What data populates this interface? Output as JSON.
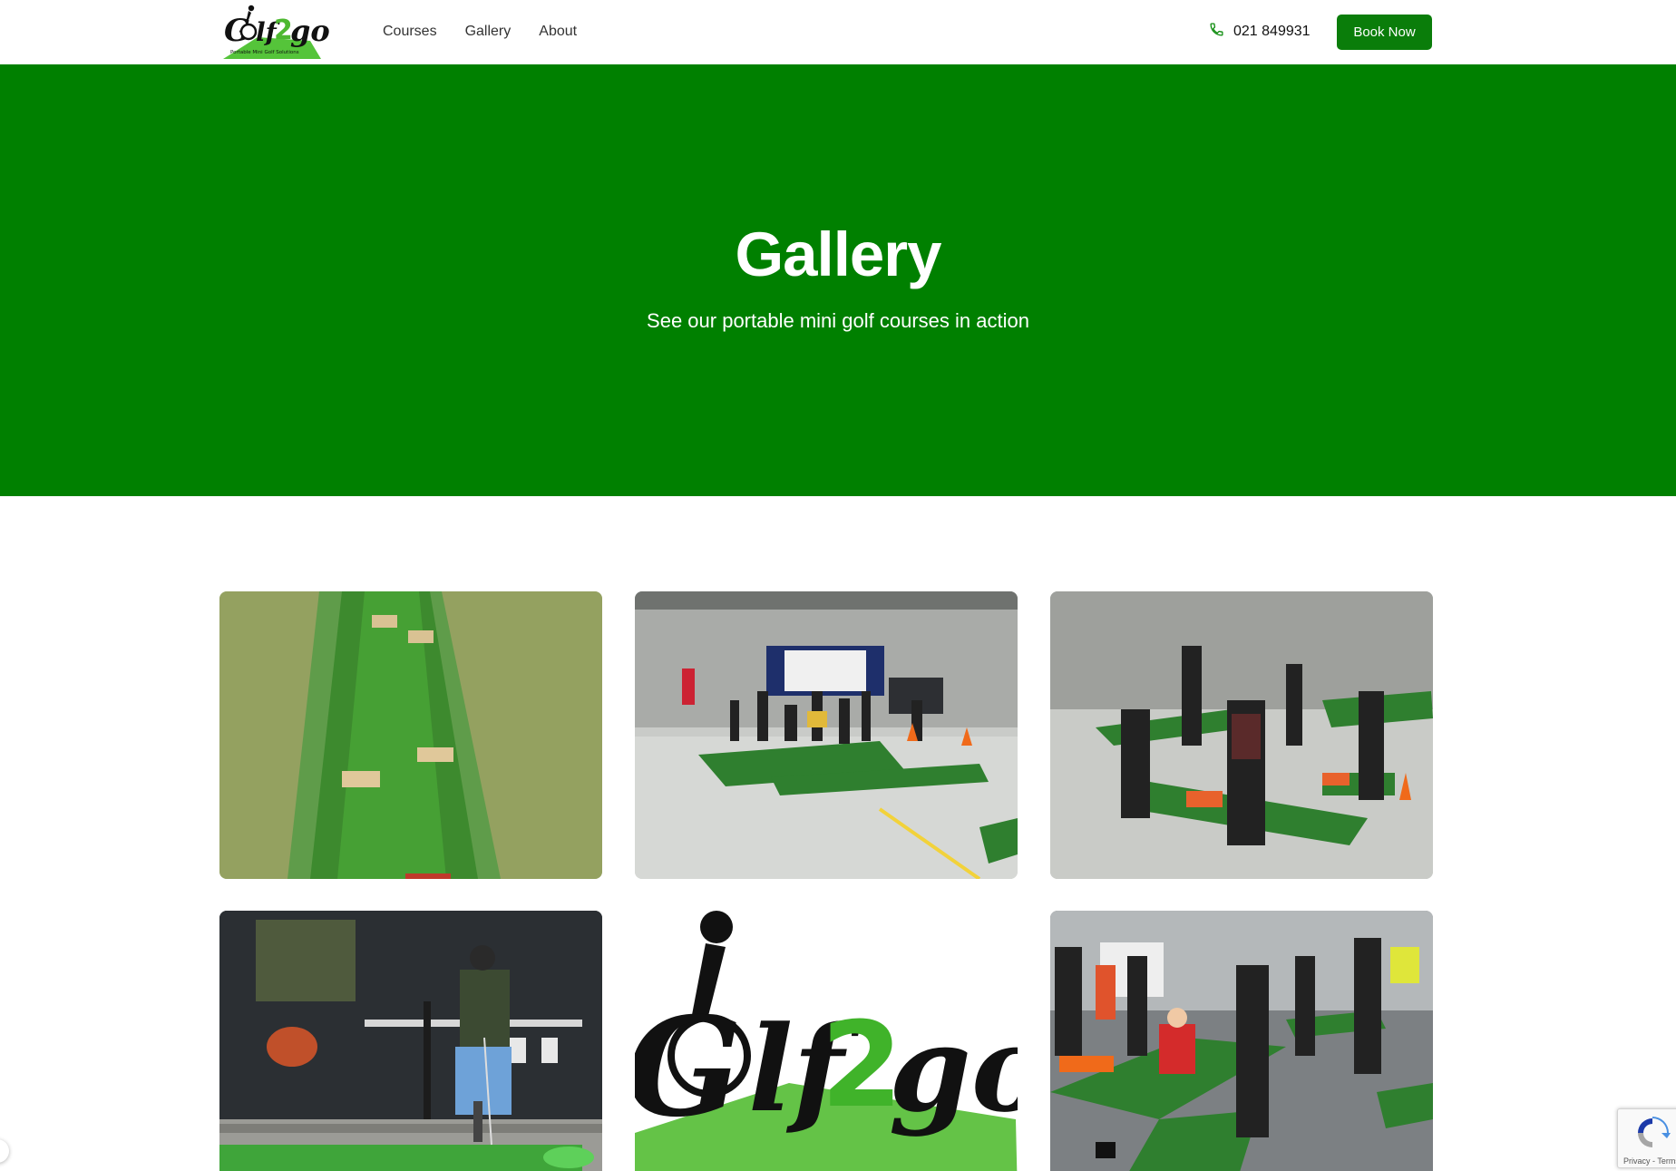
{
  "header": {
    "logo": {
      "wordmark": "Golf2GO",
      "tagline": "Portable Mini Golf Solutions"
    },
    "nav": [
      {
        "label": "Courses"
      },
      {
        "label": "Gallery"
      },
      {
        "label": "About"
      }
    ],
    "phone": {
      "number": "021 849931",
      "icon": "phone-icon"
    },
    "book_label": "Book Now"
  },
  "hero": {
    "title": "Gallery",
    "subtitle": "See our portable mini golf courses in action",
    "background": "#008000"
  },
  "gallery": {
    "images": [
      {
        "subject": "putting green on lawn with wooden blocks"
      },
      {
        "subject": "indoor warehouse mini golf event"
      },
      {
        "subject": "players on mini golf course in parking area"
      },
      {
        "subject": "man putting in front of cafe window"
      },
      {
        "subject": "Golf2GO logo"
      },
      {
        "subject": "child putting at outdoor event"
      }
    ]
  },
  "recaptcha": {
    "terms": "Privacy - Terms"
  },
  "colors": {
    "brand_green": "#0a7d0a",
    "hero_green": "#008000"
  }
}
